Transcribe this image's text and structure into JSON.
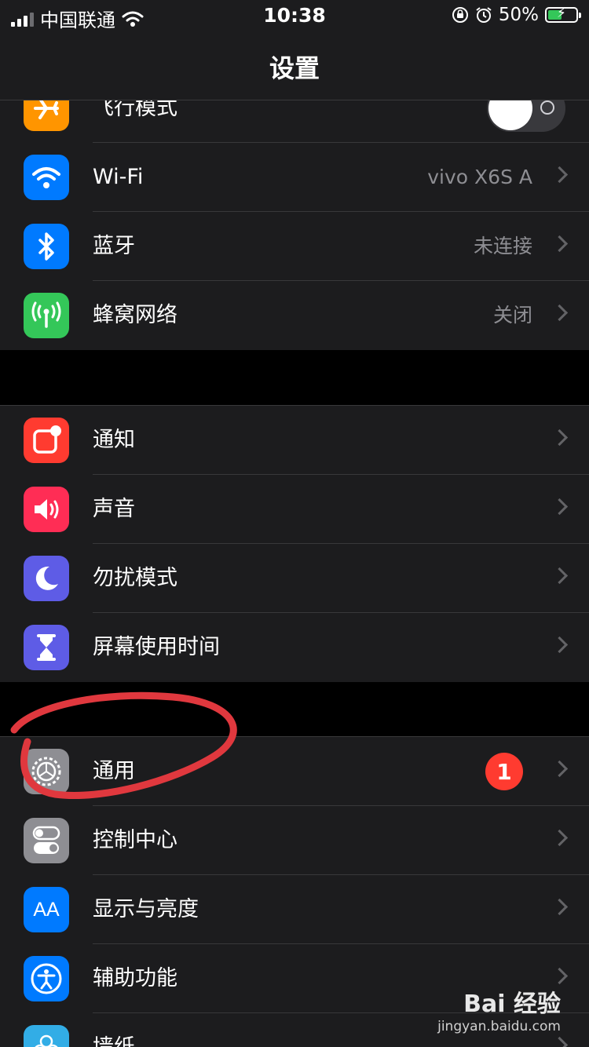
{
  "status_bar": {
    "carrier": "中国联通",
    "time": "10:38",
    "battery_percent": "50%",
    "battery_level": 0.5
  },
  "nav": {
    "title": "设置"
  },
  "groups": [
    {
      "rows": [
        {
          "label": "飞行模式",
          "icon": "airplane-icon",
          "icon_color": "#ff9500",
          "toggle_on": false
        },
        {
          "label": "Wi-Fi",
          "value": "vivo X6S A",
          "icon": "wifi-icon",
          "icon_color": "#007aff"
        },
        {
          "label": "蓝牙",
          "value": "未连接",
          "icon": "bluetooth-icon",
          "icon_color": "#007aff"
        },
        {
          "label": "蜂窝网络",
          "value": "关闭",
          "icon": "antenna-icon",
          "icon_color": "#34c759"
        }
      ]
    },
    {
      "rows": [
        {
          "label": "通知",
          "icon": "notification-icon",
          "icon_color": "#ff3b30"
        },
        {
          "label": "声音",
          "icon": "speaker-icon",
          "icon_color": "#ff2d55"
        },
        {
          "label": "勿扰模式",
          "icon": "moon-icon",
          "icon_color": "#5e5ce6"
        },
        {
          "label": "屏幕使用时间",
          "icon": "hourglass-icon",
          "icon_color": "#5e5ce6"
        }
      ]
    },
    {
      "rows": [
        {
          "label": "通用",
          "badge": "1",
          "icon": "gear-icon",
          "icon_color": "#8e8e93"
        },
        {
          "label": "控制中心",
          "icon": "switches-icon",
          "icon_color": "#8e8e93"
        },
        {
          "label": "显示与亮度",
          "icon": "text-size-icon",
          "icon_color": "#007aff",
          "icon_text": "AA"
        },
        {
          "label": "辅助功能",
          "icon": "accessibility-icon",
          "icon_color": "#007aff"
        },
        {
          "label": "墙纸",
          "icon": "wallpaper-icon",
          "icon_color": "#32ade6"
        }
      ]
    }
  ],
  "annotation": {
    "color": "#e0383e"
  },
  "watermark": {
    "brand": "Bai 经验",
    "url": "jingyan.baidu.com"
  }
}
